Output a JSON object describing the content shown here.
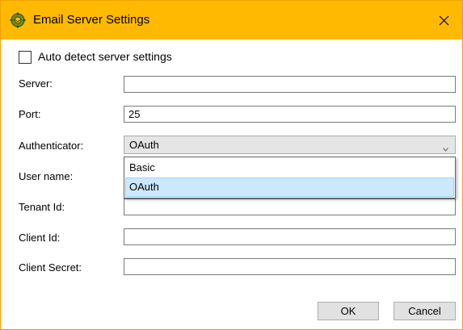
{
  "window": {
    "title": "Email Server Settings",
    "title_icon": "gear-envelope-icon",
    "close_icon": "close-icon",
    "accent_color": "#ffb900"
  },
  "auto_detect": {
    "label": "Auto detect server settings",
    "checked": false
  },
  "fields": {
    "server": {
      "label": "Server:",
      "value": ""
    },
    "port": {
      "label": "Port:",
      "value": "25"
    },
    "authenticator": {
      "label": "Authenticator:",
      "selected": "OAuth",
      "options": [
        "Basic",
        "OAuth"
      ],
      "dropdown_open": true
    },
    "user_name": {
      "label": "User name:",
      "value": ""
    },
    "tenant_id": {
      "label": "Tenant Id:",
      "value": ""
    },
    "client_id": {
      "label": "Client Id:",
      "value": ""
    },
    "client_secret": {
      "label": "Client Secret:",
      "value": ""
    }
  },
  "buttons": {
    "ok": "OK",
    "cancel": "Cancel"
  }
}
